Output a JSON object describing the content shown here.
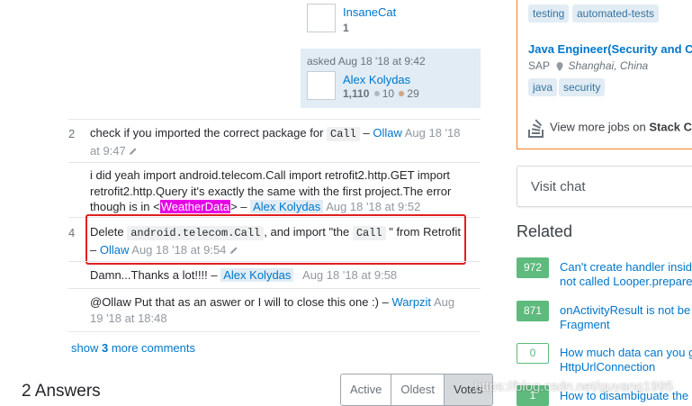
{
  "editor": {
    "name": "InsaneCat",
    "rep": "1"
  },
  "asker": {
    "action": "asked Aug 18 '18 at 9:42",
    "name": "Alex Kolydas",
    "rep": "1,110",
    "silver": "10",
    "bronze": "29"
  },
  "comments": [
    {
      "score": "2",
      "text_pre": "check if you imported the correct package for",
      "code": "Call",
      "dash": "–",
      "user": "Ollaw",
      "time": "Aug 18 '18",
      "time2": "at 9:47"
    },
    {
      "score": "",
      "line1": "i did yeah import android.telecom.Call import retrofit2.http.GET import",
      "line2": "retrofit2.http.Query it's exactly the same with the first project.The error",
      "line3_pre": "though is in <",
      "highlight": "WeatherData",
      "line3_post": "> –",
      "user": "Alex Kolydas",
      "time": "Aug 18 '18 at 9:52"
    },
    {
      "score": "4",
      "text_pre": "Delete",
      "code1": "android.telecom.Call",
      "mid": ", and import \"the",
      "code2": "Call",
      "post": "\" from Retrofit",
      "dash": "–",
      "user": "Ollaw",
      "time": "Aug 18 '18 at 9:54"
    },
    {
      "score": "",
      "text_pre": "Damn...Thanks a lot!!!! –",
      "user": "Alex Kolydas",
      "time": "Aug 18 '18 at 9:58"
    },
    {
      "score": "",
      "text_pre": "@Ollaw Put that as an aswer or I will to close this one :) –",
      "user": "Warpzit",
      "time": "Aug",
      "time2": "19 '18 at 18:48"
    }
  ],
  "show_more": {
    "pre": "show ",
    "count": "3",
    "post": " more comments"
  },
  "answers": {
    "title": "2 Answers",
    "tabs": [
      "Active",
      "Oldest",
      "Votes"
    ]
  },
  "jobs": {
    "top_tags": [
      "testing",
      "automated-tests"
    ],
    "job_title": "Java Engineer(Security and C",
    "company": "SAP",
    "location": "Shanghai, China",
    "job_tags": [
      "java",
      "security"
    ],
    "view_more": "View more jobs on",
    "view_more_site": "Stack C"
  },
  "visit_chat": "Visit chat",
  "related": {
    "title": "Related",
    "items": [
      {
        "score": "972",
        "line1": "Can't create handler insid",
        "line2": "not called Looper.preparei"
      },
      {
        "score": "871",
        "line1": "onActivityResult is not be",
        "line2": "Fragment"
      },
      {
        "score": "0",
        "line1": "How much data can you g",
        "line2": "HttpUrlConnection"
      },
      {
        "score": "1",
        "line1": "How to disambiguate the",
        "line2": ""
      }
    ]
  },
  "watermark": "https://blog.csdn.net/guyang1995",
  "colors": {
    "link": "#0077cc",
    "highlight": "#e600e6",
    "annotation_box": "#e0201f",
    "badge": "#5eba7d",
    "jobs_border": "#f48024"
  }
}
